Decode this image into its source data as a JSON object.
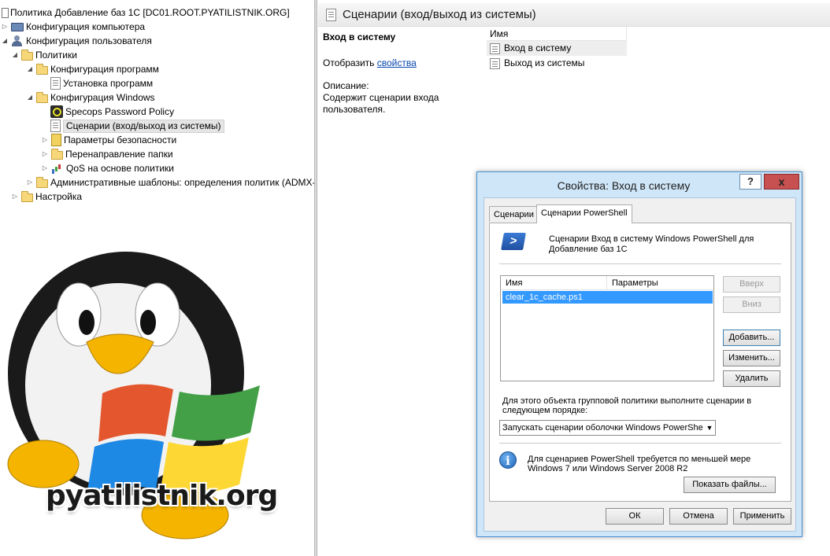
{
  "tree": {
    "items": [
      {
        "label": "Политика Добавление баз 1С [DC01.ROOT.PYATILISTNIK.ORG]"
      },
      {
        "label": "Конфигурация компьютера"
      },
      {
        "label": "Конфигурация пользователя"
      },
      {
        "label": "Политики"
      },
      {
        "label": "Конфигурация программ"
      },
      {
        "label": "Установка программ"
      },
      {
        "label": "Конфигурация Windows"
      },
      {
        "label": "Specops Password Policy"
      },
      {
        "label": "Сценарии (вход/выход из системы)"
      },
      {
        "label": "Параметры безопасности"
      },
      {
        "label": "Перенаправление папки"
      },
      {
        "label": "QoS на основе политики"
      },
      {
        "label": "Административные шаблоны: определения политик (ADMX-"
      },
      {
        "label": "Настройка"
      }
    ]
  },
  "logo": {
    "text": "pyatilistnik.org"
  },
  "details": {
    "header_title": "Сценарии (вход/выход из системы)",
    "section_heading": "Вход в систему",
    "show_prefix": "Отобразить",
    "show_link": "свойства",
    "desc_label": "Описание:",
    "desc_text": "Содержит сценарии входа пользователя.",
    "list_header": "Имя",
    "list_items": [
      "Вход в систему",
      "Выход из системы"
    ]
  },
  "dialog": {
    "title": "Свойства: Вход в систему",
    "help_symbol": "?",
    "close_symbol": "x",
    "tabs": [
      "Сценарии",
      "Сценарии PowerShell"
    ],
    "ps_description": "Сценарии Вход в систему Windows PowerShell для Добавление баз 1С",
    "list_columns": [
      "Имя",
      "Параметры"
    ],
    "scripts": [
      "clear_1c_cache.ps1"
    ],
    "buttons": {
      "up": "Вверх",
      "down": "Вниз",
      "add": "Добавить...",
      "edit": "Изменить...",
      "delete": "Удалить",
      "show_files": "Показать файлы...",
      "ok": "ОК",
      "cancel": "Отмена",
      "apply": "Применить"
    },
    "order_label": "Для этого объекта групповой политики выполните сценарии в следующем порядке:",
    "order_value": "Запускать сценарии оболочки Windows PowerShe",
    "info_text": "Для сценариев PowerShell требуется по меньшей мере Windows 7 или Windows Server 2008 R2"
  }
}
